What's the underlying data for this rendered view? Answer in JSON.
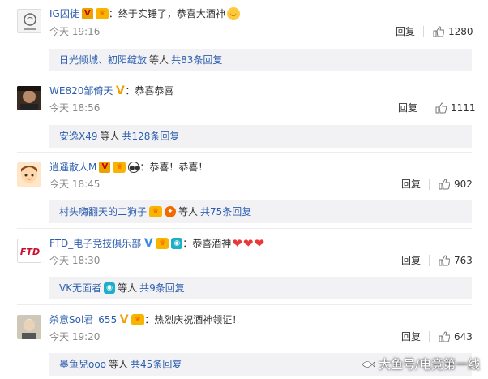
{
  "comments": [
    {
      "username": "IG囚徒",
      "text": "：终于实锤了，恭喜大酒神",
      "time": "今天 19:16",
      "reply_label": "回复",
      "likes": "1280",
      "replies": {
        "names": [
          "日光倾城",
          "初阳绽放"
        ],
        "sep": "、",
        "mid": "等人",
        "more": "共83条回复"
      }
    },
    {
      "username": "WE820邹倚天",
      "text": "：恭喜恭喜",
      "time": "今天 18:56",
      "reply_label": "回复",
      "likes": "1111",
      "replies": {
        "names": [
          "安逸X49"
        ],
        "mid": "等人",
        "more": "共128条回复"
      }
    },
    {
      "username": "逍遥散人M",
      "text": "：恭喜！恭喜！",
      "time": "今天 18:45",
      "reply_label": "回复",
      "likes": "902",
      "replies": {
        "names": [
          "村头嗨翻天的二狗子"
        ],
        "mid": "等人",
        "more": "共75条回复"
      }
    },
    {
      "username": "FTD_电子竞技俱乐部",
      "text": "：恭喜酒神",
      "time": "今天 18:30",
      "reply_label": "回复",
      "likes": "763",
      "replies": {
        "names": [
          "VK无面者"
        ],
        "mid": "等人",
        "more": "共9条回复"
      }
    },
    {
      "username": "杀意Sol君_655",
      "text": "：热烈庆祝酒神领证！",
      "time": "今天 19:20",
      "reply_label": "回复",
      "likes": "643",
      "replies": {
        "names": [
          "墨鱼兒ooo"
        ],
        "mid": "等人",
        "more": "共45条回复"
      }
    }
  ],
  "watermark": "大鱼号/电竞第一线",
  "colors": {
    "link": "#2e5fae",
    "meta": "#888888",
    "reply_bg": "#f2f2f5",
    "heart": "#e83838"
  }
}
